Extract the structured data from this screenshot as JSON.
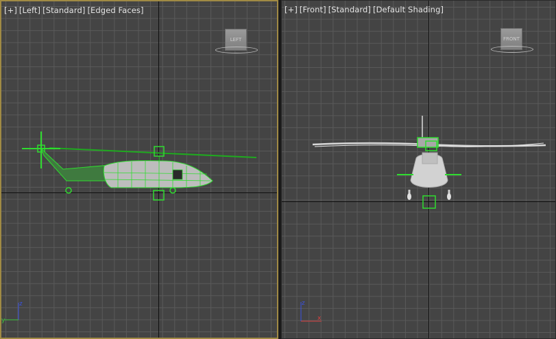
{
  "viewports": {
    "left": {
      "label": [
        "[+]",
        "[Left]",
        "[Standard]",
        "[Edged Faces]"
      ],
      "viewcube_label": "LEFT",
      "axis_labels": {
        "up": "z",
        "side": "y"
      }
    },
    "front": {
      "label": [
        "[+]",
        "[Front]",
        "[Standard]",
        "[Default Shading]"
      ],
      "viewcube_label": "FRONT",
      "axis_labels": {
        "up": "z",
        "side": "x"
      }
    }
  },
  "colors": {
    "grid_bg": "#444444",
    "grid_line": "#5a5a5a",
    "active_border": "#a08a44",
    "wireframe_green": "#2fdc2f",
    "mesh_gray": "#cfcfcf"
  }
}
